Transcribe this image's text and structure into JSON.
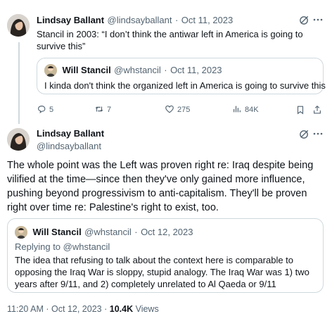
{
  "tweet1": {
    "author_name": "Lindsay Ballant",
    "handle": "@lindsayballant",
    "separator": "·",
    "date": "Oct 11, 2023",
    "text": "Stancil in 2003: “I don’t think the antiwar left in America is going to survive this”",
    "quote": {
      "author_name": "Will Stancil",
      "handle": "@whstancil",
      "separator": "·",
      "date": "Oct 11, 2023",
      "text": "I kinda don't think the organized left in America is going to survive this"
    },
    "actions": {
      "replies": "5",
      "reposts": "7",
      "likes": "275",
      "views": "84K"
    }
  },
  "tweet2": {
    "author_name": "Lindsay Ballant",
    "handle": "@lindsayballant",
    "text": "The whole point was the Left was proven right re: Iraq despite being vilified at the time—since then they've only gained more influence, pushing beyond progressivism to anti-capitalism. They'll be proven right over time re: Palestine's right to exist, too.",
    "quote": {
      "author_name": "Will Stancil",
      "handle": "@whstancil",
      "separator": "·",
      "date": "Oct 12, 2023",
      "replying_to": "Replying to @whstancil",
      "text": "The idea that refusing to talk about the context here is comparable to opposing the Iraq War is sloppy, stupid analogy. The Iraq War was 1) two years after 9/11, and 2) completely unrelated to Al Qaeda or 9/11"
    },
    "footer": {
      "time": "11:20 AM",
      "separator": "·",
      "date": "Oct 12, 2023",
      "separator2": "·",
      "views_count": "10.4K",
      "views_label": "Views"
    }
  },
  "icons": [
    "grok-icon",
    "more-icon",
    "reply-icon",
    "repost-icon",
    "like-icon",
    "views-icon",
    "bookmark-icon",
    "share-icon"
  ]
}
